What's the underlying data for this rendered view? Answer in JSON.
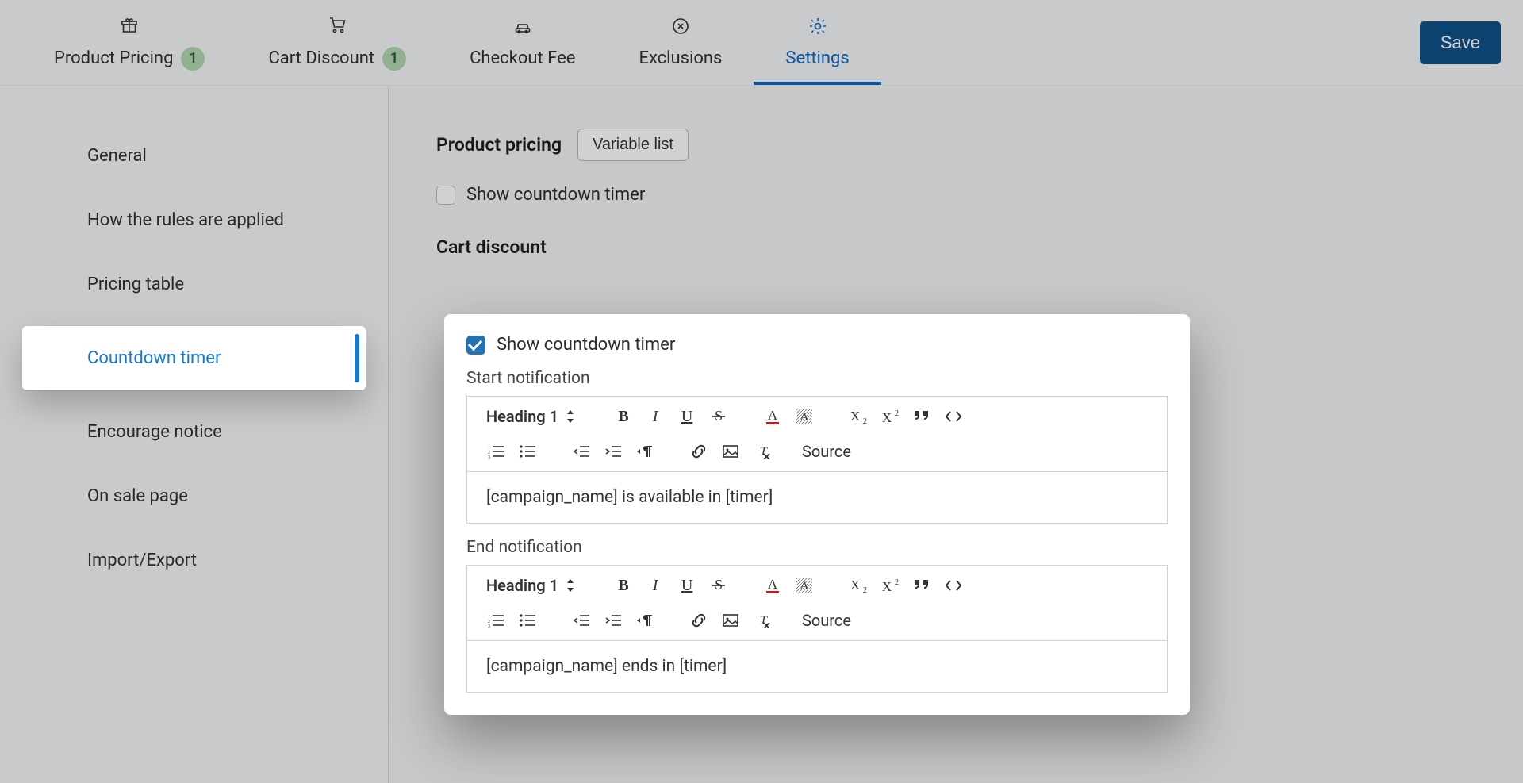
{
  "save_label": "Save",
  "tabs": {
    "product_pricing": {
      "label": "Product Pricing",
      "badge": "1"
    },
    "cart_discount": {
      "label": "Cart Discount",
      "badge": "1"
    },
    "checkout_fee": {
      "label": "Checkout Fee"
    },
    "exclusions": {
      "label": "Exclusions"
    },
    "settings": {
      "label": "Settings"
    }
  },
  "sidebar": {
    "general": "General",
    "how_rules": "How the rules are applied",
    "pricing_table": "Pricing table",
    "countdown": "Countdown timer",
    "encourage": "Encourage notice",
    "onsale": "On sale page",
    "import_export": "Import/Export"
  },
  "main": {
    "product_pricing_title": "Product pricing",
    "variable_list_btn": "Variable list",
    "pp_show_countdown_label": "Show countdown timer",
    "cart_discount_title": "Cart discount"
  },
  "card": {
    "show_countdown_label": "Show countdown timer",
    "start_notification_label": "Start notification",
    "end_notification_label": "End notification",
    "start_content": "[campaign_name] is available in [timer]",
    "end_content": "[campaign_name] ends in [timer]"
  },
  "rte": {
    "heading": "Heading 1",
    "source": "Source"
  }
}
